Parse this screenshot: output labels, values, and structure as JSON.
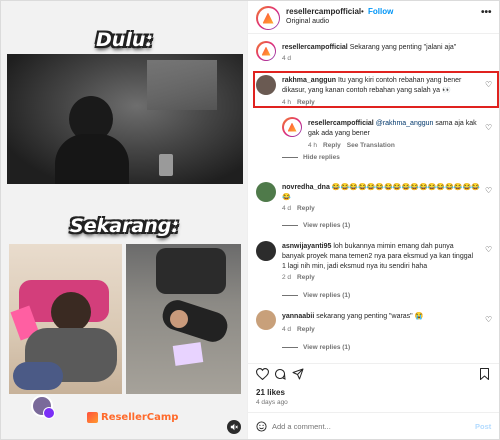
{
  "media": {
    "title_top": "Dulu:",
    "title_bottom": "Sekarang:",
    "brand": "ResellerCamp"
  },
  "header": {
    "username": "resellercampofficial",
    "separator": "•",
    "follow_label": "Follow",
    "audio": "Original audio",
    "more": "•••"
  },
  "caption": {
    "username": "resellercampofficial",
    "text": "Sekarang yang penting \"jalani aja\"",
    "time": "4 d"
  },
  "comments": [
    {
      "username": "rakhma_anggun",
      "text": "Itu yang kiri contoh rebahan yang bener dikasur, yang kanan contoh rebahan yang salah ya 👀",
      "time": "4 h",
      "reply": "Reply"
    },
    {
      "username": "resellercampofficial",
      "mention": "@rakhma_anggun",
      "text": "sama aja kak gak ada yang bener",
      "time": "4 h",
      "reply": "Reply",
      "see_translation": "See Translation",
      "hide_replies": "Hide replies"
    },
    {
      "username": "novredha_dna",
      "text": "😂😂😂😂😂😂😂😂😂😂😂😂😂😂😂😂😂😂",
      "time": "4 d",
      "reply": "Reply",
      "view_replies": "View replies (1)"
    },
    {
      "username": "asnwijayanti95",
      "text": "loh bukannya mimin emang dah punya banyak proyek mana temen2 nya para eksmud ya kan tinggal 1 lagi nih min, jadi eksmud nya itu sendiri haha",
      "time": "2 d",
      "reply": "Reply",
      "view_replies": "View replies (1)"
    },
    {
      "username": "yannaabii",
      "text": "sekarang yang penting \"waras\" 😭",
      "time": "4 d",
      "reply": "Reply",
      "view_replies": "View replies (1)"
    }
  ],
  "actions": {
    "like_icon": "heart-icon",
    "comment_icon": "comment-icon",
    "share_icon": "share-icon",
    "save_icon": "bookmark-icon"
  },
  "likes": "21 likes",
  "post_time": "4 days ago",
  "comment_box": {
    "placeholder": "Add a comment...",
    "post_label": "Post"
  },
  "colors": {
    "accent": "#0095f6",
    "highlight": "#e0221f",
    "brand": "#ff6a2b"
  }
}
